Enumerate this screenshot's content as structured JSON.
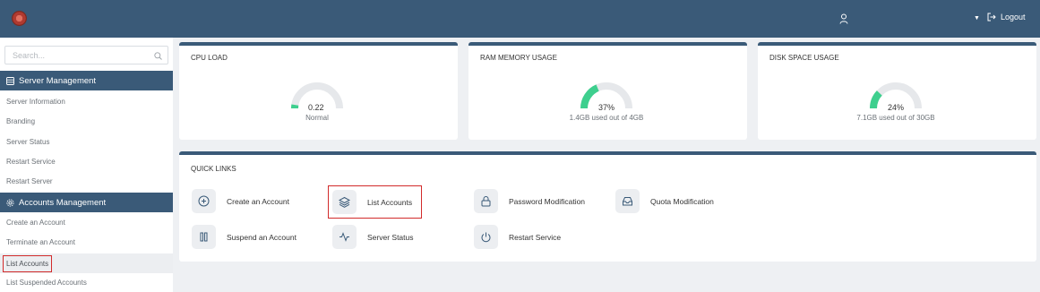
{
  "header": {
    "logout_label": "Logout"
  },
  "sidebar": {
    "search_placeholder": "Search...",
    "sections": [
      {
        "title": "Server Management",
        "items": [
          "Server Information",
          "Branding",
          "Server Status",
          "Restart Service",
          "Restart Server"
        ]
      },
      {
        "title": "Accounts Management",
        "items": [
          "Create an Account",
          "Terminate an Account",
          "List Accounts",
          "List Suspended Accounts"
        ]
      }
    ],
    "active_item": "List Accounts"
  },
  "cards": {
    "cpu": {
      "title": "CPU LOAD",
      "value": "0.22",
      "status": "Normal",
      "fill_fraction": 0.05
    },
    "ram": {
      "title": "RAM MEMORY USAGE",
      "value": "37%",
      "detail": "1.4GB used out of 4GB",
      "fill_fraction": 0.37
    },
    "disk": {
      "title": "DISK SPACE USAGE",
      "value": "24%",
      "detail": "7.1GB used out of 30GB",
      "fill_fraction": 0.24
    }
  },
  "quick_links": {
    "title": "QUICK LINKS",
    "items": [
      {
        "label": "Create an Account",
        "icon": "plus-circle-icon"
      },
      {
        "label": "List Accounts",
        "icon": "layers-icon"
      },
      {
        "label": "Password Modification",
        "icon": "lock-icon"
      },
      {
        "label": "Quota Modification",
        "icon": "inbox-icon"
      },
      {
        "label": "Suspend an Account",
        "icon": "pause-icon"
      },
      {
        "label": "Server Status",
        "icon": "activity-icon"
      },
      {
        "label": "Restart Service",
        "icon": "power-icon"
      }
    ]
  },
  "colors": {
    "primary": "#3a5a78",
    "gauge_fill": "#3ecf8e",
    "gauge_track": "#e6e8eb",
    "highlight": "#d22b2b"
  }
}
